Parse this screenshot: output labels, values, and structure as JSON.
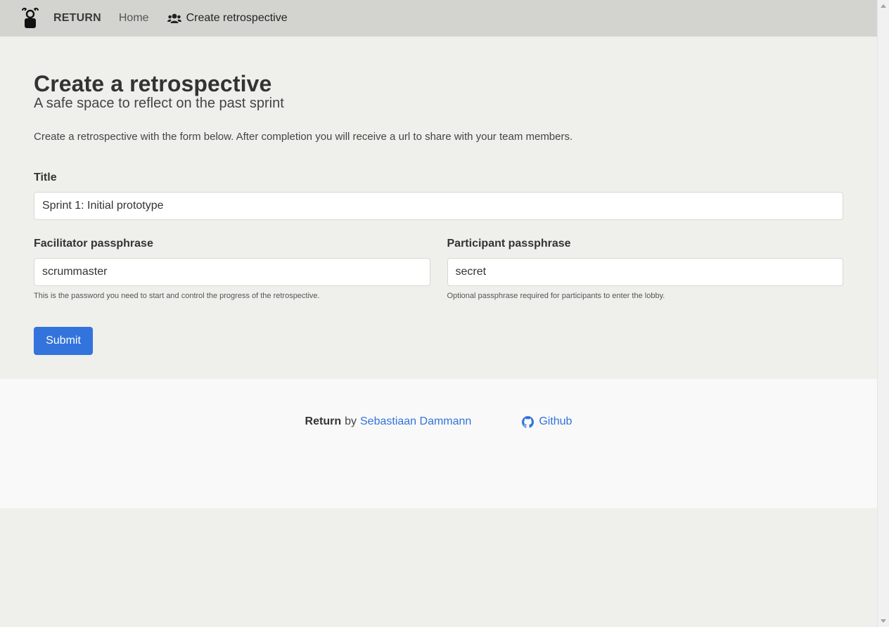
{
  "navbar": {
    "brand_logo_icon": "return-logo-icon",
    "brand_name": "RETURN",
    "home_label": "Home",
    "create_icon": "users-icon",
    "create_label": "Create retrospective"
  },
  "main": {
    "title": "Create a retrospective",
    "subtitle": "A safe space to reflect on the past sprint",
    "intro": "Create a retrospective with the form below. After completion you will receive a url to share with your team members."
  },
  "form": {
    "title_label": "Title",
    "title_value": "Sprint 1: Initial prototype",
    "facilitator_label": "Facilitator passphrase",
    "facilitator_value": "scrummaster",
    "facilitator_help": "This is the password you need to start and control the progress of the retrospective.",
    "participant_label": "Participant passphrase",
    "participant_value": "secret",
    "participant_help": "Optional passphrase required for participants to enter the lobby.",
    "submit_label": "Submit"
  },
  "footer": {
    "app_name": "Return",
    "by": "by",
    "author": "Sebastiaan Dammann",
    "github_icon": "github-icon",
    "github_label": "Github"
  },
  "colors": {
    "primary": "#3273dc",
    "navbar_bg": "#d3d3cf",
    "page_bg": "#efefeb",
    "footer_bg": "#f9f9f9"
  }
}
